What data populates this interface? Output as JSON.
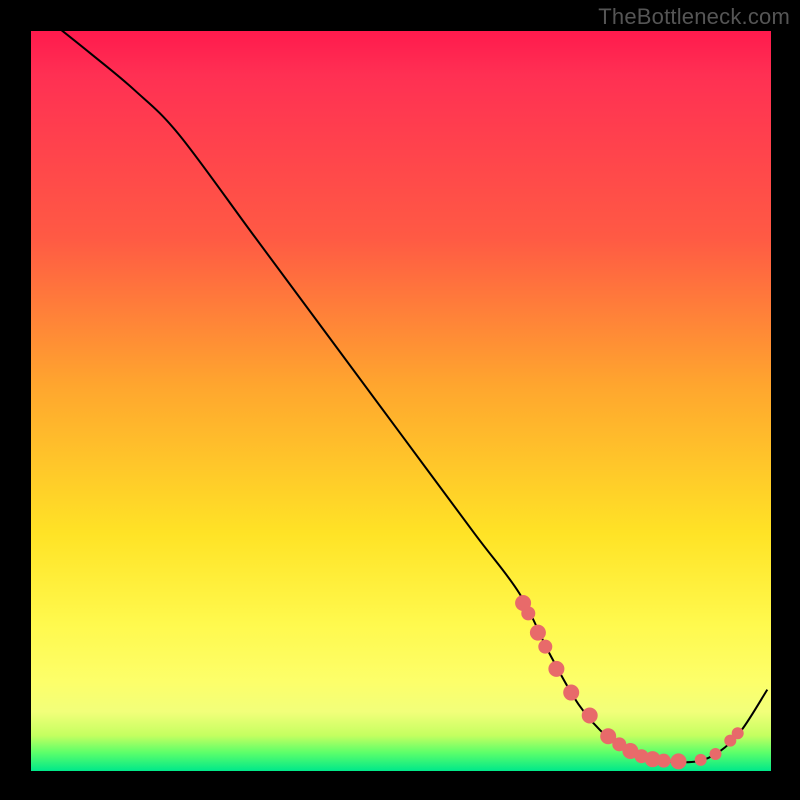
{
  "watermark": "TheBottleneck.com",
  "chart_data": {
    "type": "line",
    "title": "",
    "xlabel": "",
    "ylabel": "",
    "xlim": [
      0,
      100
    ],
    "ylim": [
      0,
      100
    ],
    "series": [
      {
        "name": "bottleneck-curve",
        "x": [
          3,
          8,
          14,
          20,
          30,
          40,
          50,
          60,
          66,
          70,
          74,
          78,
          82,
          86,
          90,
          93,
          96,
          99.5
        ],
        "y": [
          101,
          97,
          92,
          86,
          72.5,
          59,
          45.5,
          32,
          24,
          16,
          9,
          4.5,
          2,
          1.3,
          1.3,
          2.6,
          5.5,
          11
        ]
      }
    ],
    "markers": {
      "name": "highlight-dots",
      "x": [
        66.5,
        67.2,
        68.5,
        69.5,
        71,
        73,
        75.5,
        78,
        79.5,
        81,
        82.5,
        84,
        85.5,
        87.5,
        90.5,
        92.5,
        94.5,
        95.5
      ],
      "y": [
        22.7,
        21.3,
        18.7,
        16.8,
        13.8,
        10.6,
        7.5,
        4.7,
        3.6,
        2.7,
        2.0,
        1.6,
        1.4,
        1.3,
        1.5,
        2.3,
        4.1,
        5.1
      ],
      "r": [
        8,
        7,
        8,
        7,
        8,
        8,
        8,
        8,
        7,
        8,
        7,
        8,
        7,
        8,
        6,
        6,
        6,
        6
      ]
    },
    "gradient_stops": [
      {
        "pos": 0,
        "color": "#ff1a4d"
      },
      {
        "pos": 0.28,
        "color": "#ff5a44"
      },
      {
        "pos": 0.48,
        "color": "#ffa62e"
      },
      {
        "pos": 0.68,
        "color": "#ffe326"
      },
      {
        "pos": 0.88,
        "color": "#fdff6a"
      },
      {
        "pos": 0.975,
        "color": "#5dff6a"
      },
      {
        "pos": 1.0,
        "color": "#00e88a"
      }
    ]
  }
}
